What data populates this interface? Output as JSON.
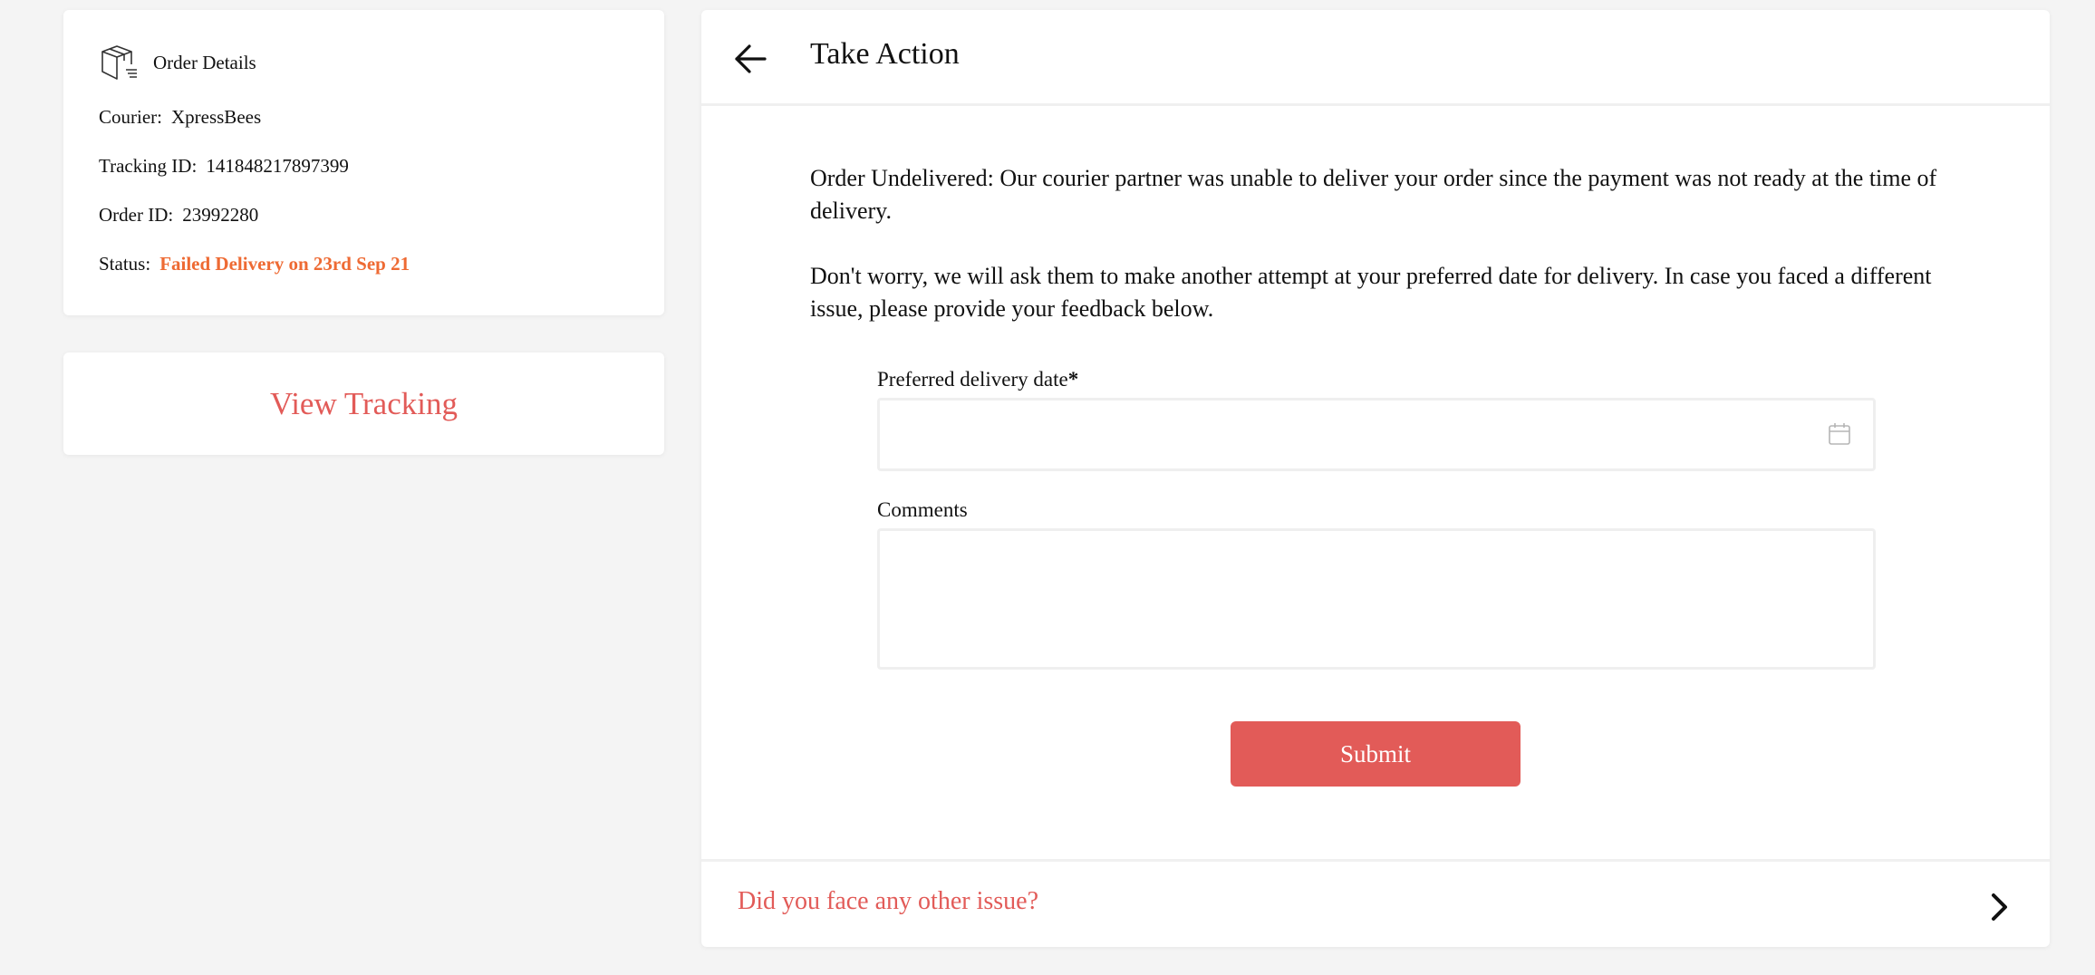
{
  "order_details": {
    "title": "Order Details",
    "icon": "package-icon",
    "courier_label": "Courier:",
    "courier_value": "XpressBees",
    "tracking_label": "Tracking ID:",
    "tracking_value": "141848217897399",
    "order_label": "Order ID:",
    "order_value": "23992280",
    "status_label": "Status:",
    "status_value": "Failed Delivery on 23rd Sep 21",
    "status_color": "#ee6a33"
  },
  "tracking": {
    "label": "View Tracking"
  },
  "action": {
    "back_icon": "arrow-left-icon",
    "title": "Take Action",
    "message_1": "Order Undelivered: Our courier partner was unable to deliver your order since the payment was not ready at the time of delivery.",
    "message_2": "Don't worry, we will ask them to make another attempt at your preferred date for delivery. In case you faced a different issue, please provide your feedback below.",
    "date_label": "Preferred delivery date",
    "date_required_mark": "*",
    "date_value": "",
    "calendar_icon": "calendar-icon",
    "comments_label": "Comments",
    "comments_value": "",
    "submit_label": "Submit",
    "footer_text": "Did you face any other issue?",
    "footer_icon": "chevron-right-icon"
  },
  "colors": {
    "accent": "#e25b58",
    "status": "#ee6a33",
    "background": "#f4f4f4"
  }
}
